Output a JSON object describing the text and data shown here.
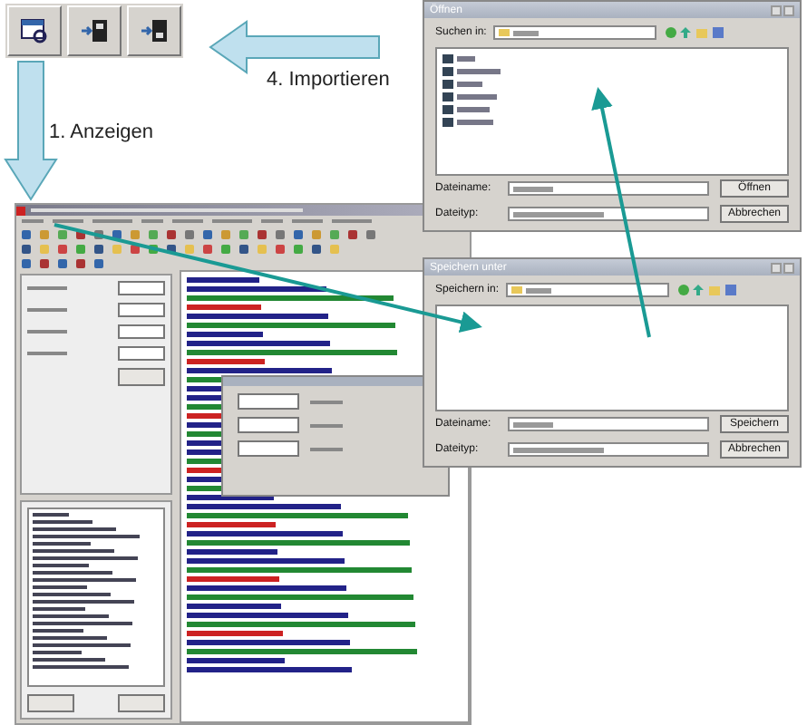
{
  "steps": [
    {
      "label": "4. Importieren"
    },
    {
      "label": "1. Anzeigen"
    }
  ],
  "dialogs": [
    {
      "title": "Öffnen",
      "location_label": "Suchen in:",
      "name_label": "Dateiname:",
      "type_label": "Dateityp:",
      "buttons": [
        "Öffnen",
        "Abbrechen"
      ]
    },
    {
      "title": "Speichern unter",
      "location_label": "Speichern in:",
      "name_label": "Dateiname:",
      "type_label": "Dateityp:",
      "buttons": [
        "Speichern",
        "Abbrechen"
      ]
    }
  ]
}
